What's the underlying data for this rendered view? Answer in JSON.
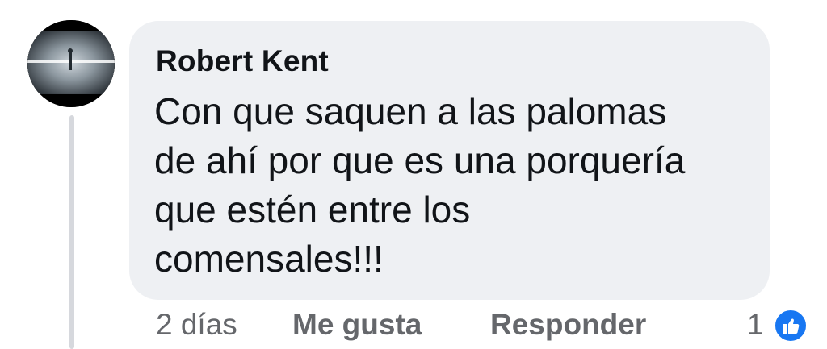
{
  "comment": {
    "author": "Robert Kent",
    "text_lines": [
      "Con que saquen a las palomas",
      "de ahí por que es una porquería",
      "que estén entre los",
      "comensales!!!"
    ]
  },
  "actions": {
    "timestamp": "2 días",
    "like_label": "Me gusta",
    "reply_label": "Responder",
    "reaction_count": "1"
  },
  "icons": {
    "avatar": "profile-photo",
    "reaction": "thumbs-up-icon"
  },
  "colors": {
    "bubble": "#eef0f3",
    "text": "#111418",
    "secondary_text": "#65676b",
    "like_blue": "#1877f2"
  }
}
